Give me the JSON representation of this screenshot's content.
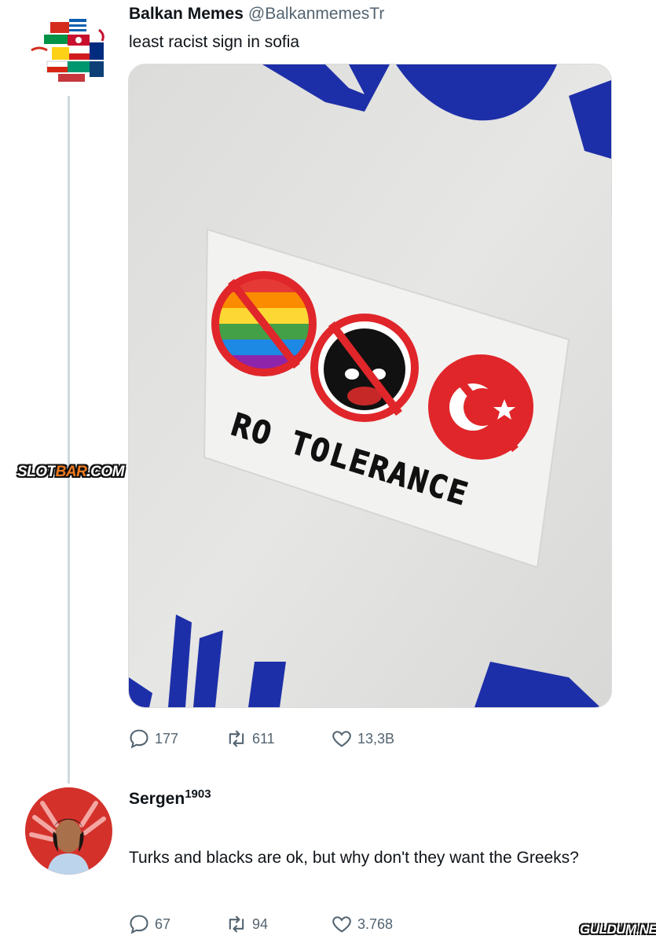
{
  "tweet": {
    "display_name": "Balkan Memes",
    "handle": "@BalkanmemesTr",
    "text": "least racist sign in sofia",
    "media": {
      "sticker_text": "RO TOLERANCE"
    },
    "stats": {
      "replies": "177",
      "retweets": "611",
      "likes": "13,3B"
    }
  },
  "reply": {
    "display_name": "Sergen",
    "name_suffix": "1903",
    "text": "Turks and blacks are ok, but why don't they want the Greeks?",
    "stats": {
      "replies": "67",
      "retweets": "94",
      "likes": "3.768"
    }
  },
  "watermarks": {
    "left_a": "SLOT",
    "left_b": "BAR",
    "left_c": ".COM",
    "right": "GULDUM.NET"
  },
  "colors": {
    "accent_blue": "#1d2fa8",
    "prohibition_red": "#e0262a",
    "muted_text": "#536471"
  }
}
